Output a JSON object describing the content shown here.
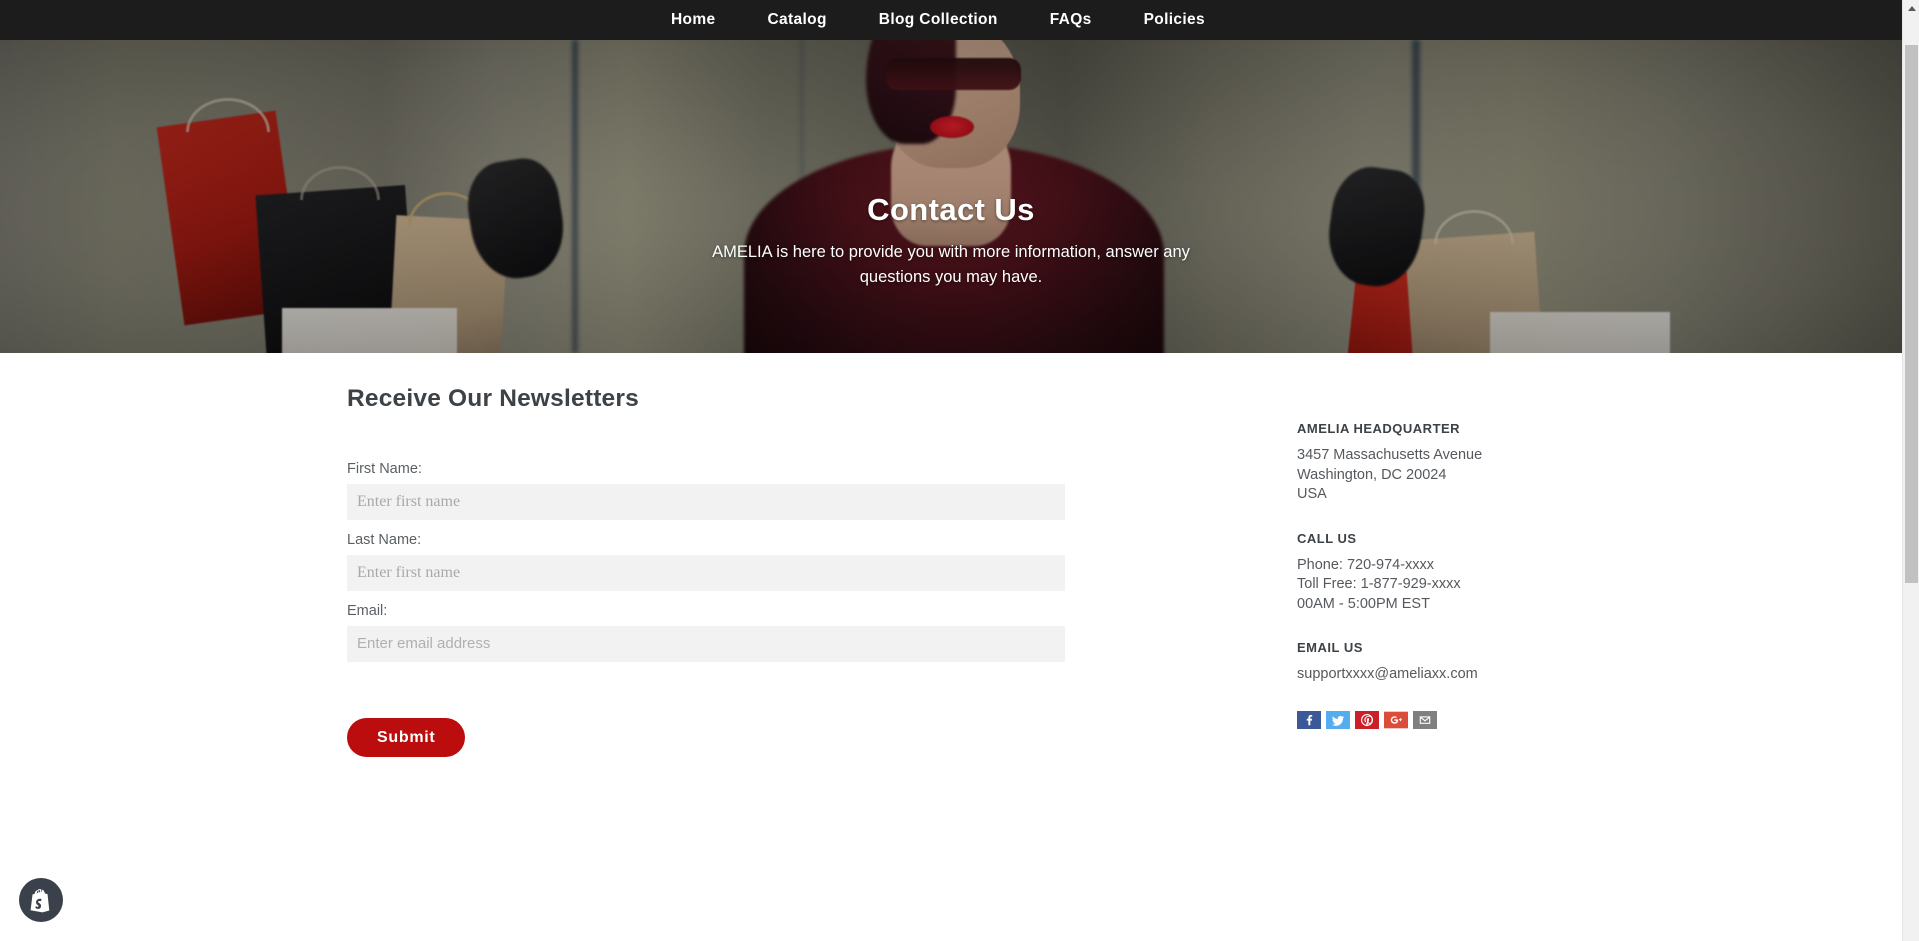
{
  "nav": {
    "items": [
      {
        "label": "Home"
      },
      {
        "label": "Catalog"
      },
      {
        "label": "Blog Collection"
      },
      {
        "label": "FAQs"
      },
      {
        "label": "Policies"
      }
    ]
  },
  "hero": {
    "title": "Contact Us",
    "subtitle": "AMELIA is here to provide you with more information, answer any questions you may have."
  },
  "form": {
    "section_title": "Receive Our Newsletters",
    "fields": [
      {
        "label": "First Name:",
        "value": "",
        "placeholder": "Enter first name"
      },
      {
        "label": "Last Name:",
        "value": "",
        "placeholder": "Enter first name"
      },
      {
        "label": "Email:",
        "value": "",
        "placeholder": "Enter email address"
      }
    ],
    "submit_label": "Submit"
  },
  "contact": {
    "headquarter": {
      "heading": "AMELIA HEADQUARTER",
      "line1": "3457 Massachusetts Avenue",
      "line2": "Washington, DC 20024",
      "line3": "USA"
    },
    "call": {
      "heading": "CALL US",
      "line1": "Phone: 720-974-xxxx",
      "line2": "Toll Free: 1-877-929-xxxx",
      "line3": "00AM - 5:00PM EST"
    },
    "email": {
      "heading": "EMAIL US",
      "address": "supportxxxx@ameliaxx.com"
    },
    "social": [
      {
        "name": "facebook-icon",
        "color": "#3b5998"
      },
      {
        "name": "twitter-icon",
        "color": "#55acee"
      },
      {
        "name": "pinterest-icon",
        "color": "#cb2027"
      },
      {
        "name": "googleplus-icon",
        "color": "#dd4b39"
      },
      {
        "name": "email-icon",
        "color": "#808080"
      }
    ]
  },
  "badge": {
    "name": "shopify-badge"
  },
  "colors": {
    "nav_bg": "#1c1c1c",
    "submit_bg": "#bb0d0d",
    "input_bg": "#f2f2f2",
    "heading": "#3d4246"
  },
  "scrollbar": {
    "up": "▲",
    "down": "▼"
  }
}
